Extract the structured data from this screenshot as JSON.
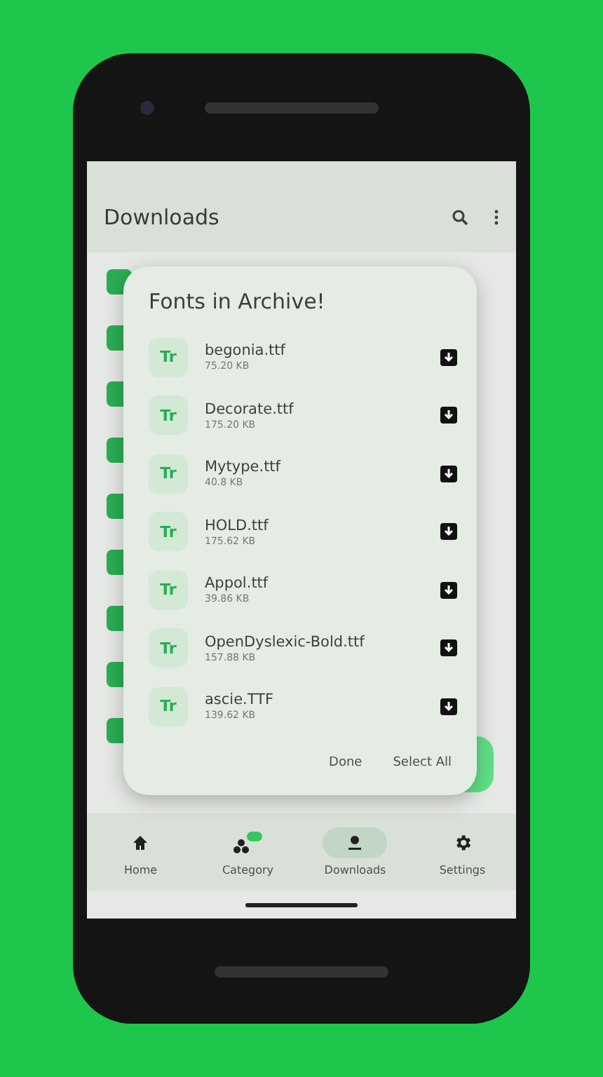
{
  "app_bar": {
    "title": "Downloads"
  },
  "dialog": {
    "title": "Fonts in Archive!",
    "files": [
      {
        "badge": "Tr",
        "name": "begonia.ttf",
        "size": "75.20 KB"
      },
      {
        "badge": "Tr",
        "name": "Decorate.ttf",
        "size": "175.20 KB"
      },
      {
        "badge": "Tr",
        "name": "Mytype.ttf",
        "size": "40.8 KB"
      },
      {
        "badge": "Tr",
        "name": "HOLD.ttf",
        "size": "175.62 KB"
      },
      {
        "badge": "Tr",
        "name": "Appol.ttf",
        "size": "39.86 KB"
      },
      {
        "badge": "Tr",
        "name": "OpenDyslexic-Bold.ttf",
        "size": "157.88 KB"
      },
      {
        "badge": "Tr",
        "name": "ascie.TTF",
        "size": "139.62 KB"
      }
    ],
    "actions": [
      "Done",
      "Select All"
    ]
  },
  "nav": [
    {
      "kind": "home",
      "label": "Home",
      "selected": false
    },
    {
      "kind": "category",
      "label": "Category",
      "selected": false
    },
    {
      "kind": "download",
      "label": "Downloads",
      "selected": true
    },
    {
      "kind": "settings",
      "label": "Settings",
      "selected": false
    }
  ]
}
